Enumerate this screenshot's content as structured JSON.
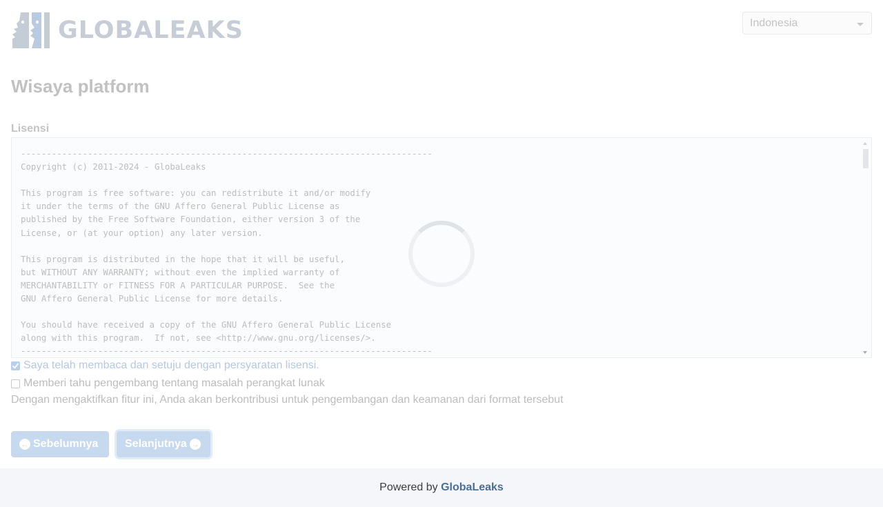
{
  "header": {
    "logo_text": "GLOBALEAKS",
    "language": "Indonesia"
  },
  "page": {
    "title": "Wisaya platform"
  },
  "license": {
    "label": "Lisensi",
    "text": "--------------------------------------------------------------------------------\nCopyright (c) 2011-2024 - GlobaLeaks\n\nThis program is free software: you can redistribute it and/or modify\nit under the terms of the GNU Affero General Public License as\npublished by the Free Software Foundation, either version 3 of the\nLicense, or (at your option) any later version.\n\nThis program is distributed in the hope that it will be useful,\nbut WITHOUT ANY WARRANTY; without even the implied warranty of\nMERCHANTABILITY or FITNESS FOR A PARTICULAR PURPOSE.  See the\nGNU Affero General Public License for more details.\n\nYou should have received a copy of the GNU Affero General Public License\nalong with this program.  If not, see <http://www.gnu.org/licenses/>.\n--------------------------------------------------------------------------------",
    "accept_label": "Saya telah membaca dan setuju dengan persyaratan lisensi.",
    "accept_checked": true
  },
  "telemetry": {
    "label": "Memberi tahu pengembang tentang masalah perangkat lunak",
    "checked": false,
    "note": "Dengan mengaktifkan fitur ini, Anda akan berkontribusi untuk pengembangan dan keamanan dari format tersebut"
  },
  "buttons": {
    "prev_label": "Sebelumnya",
    "next_label": "Selanjutnya"
  },
  "footer": {
    "prefix": "Powered by",
    "link": "GlobaLeaks"
  },
  "colors": {
    "button_bg": "#c7d9ee",
    "footer_link": "#4a6e96",
    "logo_gray": "#c6cdd6",
    "logo_blue": "#b7cbe6"
  },
  "icons": [
    "logo-mark-icon",
    "caret-down-icon",
    "spinner-icon",
    "arrow-circle-left-icon",
    "arrow-circle-right-icon",
    "check-icon"
  ]
}
